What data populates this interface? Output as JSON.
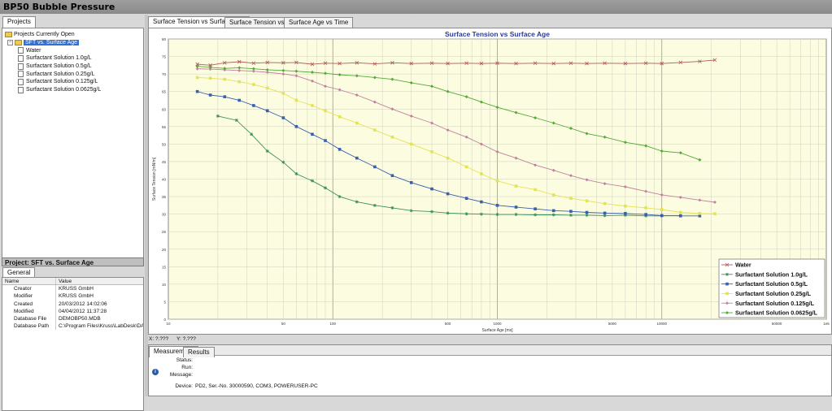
{
  "window": {
    "title": "BP50 Bubble Pressure"
  },
  "left_panel": {
    "tab": "Projects",
    "tree": {
      "root": "Projects Currently Open",
      "project": "SFT vs. Surface Age",
      "items": [
        "Water",
        "Surfactant Solution 1.0g/L",
        "Surfactant Solution 0.5g/L",
        "Surfactant Solution 0.25g/L",
        "Surfactant Solution 0.125g/L",
        "Surfactant Solution 0.0625g/L"
      ]
    }
  },
  "properties": {
    "header": "Project: SFT vs. Surface Age",
    "tab": "General",
    "columns": [
      "Name",
      "Value"
    ],
    "rows": [
      {
        "name": "Creator",
        "value": "KRUSS GmbH"
      },
      {
        "name": "Modifier",
        "value": "KRUSS GmbH"
      },
      {
        "name": "Created",
        "value": "20/03/2012 14:02:06"
      },
      {
        "name": "Modified",
        "value": "04/04/2012 11:37:28"
      },
      {
        "name": "Database File",
        "value": "DEMOBP50.MDB"
      },
      {
        "name": "Database Path",
        "value": "C:\\Program Files\\Kruss\\LabDesk\\DA"
      }
    ]
  },
  "chart_tabs": [
    "Surface Tension vs Surface Age",
    "Surface Tension vs Time",
    "Surface Age vs Time"
  ],
  "coords": {
    "x": "X: ?.???",
    "y": "Y: ?.???"
  },
  "bottom_panel": {
    "tabs": [
      "Measurement",
      "Results"
    ],
    "status_label": "Status:",
    "run_label": "Run:",
    "message_label": "Message:",
    "device_label": "Device:",
    "device_value": "PD2, Ser.-No. 30000590, COM3, POWERUSER-PC"
  },
  "colors": {
    "plot_bg": "#fcfde0",
    "title": "#2a3a9c"
  },
  "chart_data": {
    "type": "line",
    "title": "Surface Tension vs Surface Age",
    "xlabel": "Surface Age [ms]",
    "ylabel": "Surface Tension [mN/m]",
    "xscale": "log",
    "xlim": [
      10,
      100000
    ],
    "ylim": [
      0,
      80
    ],
    "x_tick_labels": [
      {
        "v": 10,
        "t": "10"
      },
      {
        "v": 50,
        "t": "50"
      },
      {
        "v": 100,
        "t": "100"
      },
      {
        "v": 500,
        "t": "500"
      },
      {
        "v": 1000,
        "t": "1000"
      },
      {
        "v": 5000,
        "t": "5000"
      },
      {
        "v": 10000,
        "t": "10000"
      },
      {
        "v": 50000,
        "t": "50000"
      },
      {
        "v": 100000,
        "t": "1e5"
      }
    ],
    "y_ticks": [
      0,
      5,
      10,
      15,
      20,
      25,
      30,
      35,
      40,
      45,
      50,
      55,
      60,
      65,
      70,
      75,
      80
    ],
    "grid": true,
    "legend_position": "bottom-right",
    "series": [
      {
        "name": "Water",
        "color": "#b05a5a",
        "marker": "x",
        "points": [
          [
            15,
            72.8
          ],
          [
            18,
            72.5
          ],
          [
            22,
            73.2
          ],
          [
            27,
            73.5
          ],
          [
            33,
            73.1
          ],
          [
            40,
            73.3
          ],
          [
            50,
            73.2
          ],
          [
            60,
            73.3
          ],
          [
            75,
            72.8
          ],
          [
            90,
            73.1
          ],
          [
            110,
            73.0
          ],
          [
            140,
            73.2
          ],
          [
            180,
            72.9
          ],
          [
            230,
            73.2
          ],
          [
            300,
            73.0
          ],
          [
            400,
            73.1
          ],
          [
            500,
            73.0
          ],
          [
            650,
            73.1
          ],
          [
            800,
            73.0
          ],
          [
            1000,
            73.1
          ],
          [
            1300,
            73.0
          ],
          [
            1700,
            73.1
          ],
          [
            2200,
            73.0
          ],
          [
            2800,
            73.1
          ],
          [
            3500,
            73.0
          ],
          [
            4500,
            73.1
          ],
          [
            6000,
            73.0
          ],
          [
            8000,
            73.1
          ],
          [
            10000,
            73.0
          ],
          [
            13000,
            73.3
          ],
          [
            17000,
            73.6
          ],
          [
            21000,
            74.0
          ]
        ]
      },
      {
        "name": "Surfactant Solution 1.0g/L",
        "color": "#3a8f5a",
        "marker": "star",
        "points": [
          [
            20,
            58
          ],
          [
            26,
            56.8
          ],
          [
            32,
            52.8
          ],
          [
            40,
            48
          ],
          [
            50,
            44.8
          ],
          [
            60,
            41.5
          ],
          [
            75,
            39.5
          ],
          [
            90,
            37.5
          ],
          [
            110,
            35
          ],
          [
            140,
            33.5
          ],
          [
            180,
            32.5
          ],
          [
            230,
            31.8
          ],
          [
            300,
            31
          ],
          [
            400,
            30.7
          ],
          [
            500,
            30.3
          ],
          [
            650,
            30.1
          ],
          [
            800,
            30
          ],
          [
            1000,
            29.9
          ],
          [
            1300,
            29.9
          ],
          [
            1700,
            29.8
          ],
          [
            2200,
            29.8
          ],
          [
            2800,
            29.7
          ],
          [
            3500,
            29.7
          ],
          [
            4500,
            29.6
          ],
          [
            6000,
            29.7
          ],
          [
            8000,
            29.5
          ],
          [
            10000,
            29.5
          ],
          [
            13000,
            29.6
          ]
        ]
      },
      {
        "name": "Surfactant Solution 0.5g/L",
        "color": "#3a5fb0",
        "marker": "square",
        "points": [
          [
            15,
            65
          ],
          [
            18,
            64
          ],
          [
            22,
            63.5
          ],
          [
            27,
            62.5
          ],
          [
            33,
            61
          ],
          [
            40,
            59.5
          ],
          [
            50,
            57.5
          ],
          [
            60,
            55
          ],
          [
            75,
            52.8
          ],
          [
            90,
            51
          ],
          [
            110,
            48.5
          ],
          [
            140,
            46
          ],
          [
            180,
            43.5
          ],
          [
            230,
            41
          ],
          [
            300,
            39
          ],
          [
            400,
            37.2
          ],
          [
            500,
            35.8
          ],
          [
            650,
            34.5
          ],
          [
            800,
            33.5
          ],
          [
            1000,
            32.5
          ],
          [
            1300,
            32
          ],
          [
            1700,
            31.5
          ],
          [
            2200,
            31
          ],
          [
            2800,
            30.8
          ],
          [
            3500,
            30.5
          ],
          [
            4500,
            30.3
          ],
          [
            6000,
            30.2
          ],
          [
            8000,
            29.9
          ],
          [
            10000,
            29.6
          ],
          [
            13000,
            29.5
          ],
          [
            17000,
            29.5
          ]
        ]
      },
      {
        "name": "Surfactant Solution 0.25g/L",
        "color": "#e3e356",
        "marker": "square",
        "points": [
          [
            15,
            69
          ],
          [
            18,
            68.8
          ],
          [
            22,
            68.5
          ],
          [
            27,
            67.8
          ],
          [
            33,
            67
          ],
          [
            40,
            66
          ],
          [
            50,
            64.5
          ],
          [
            60,
            62.5
          ],
          [
            75,
            61
          ],
          [
            90,
            59.5
          ],
          [
            110,
            57.8
          ],
          [
            140,
            56
          ],
          [
            180,
            54
          ],
          [
            230,
            52
          ],
          [
            300,
            50
          ],
          [
            400,
            47.8
          ],
          [
            500,
            46
          ],
          [
            650,
            43.5
          ],
          [
            800,
            41.5
          ],
          [
            1000,
            39.5
          ],
          [
            1300,
            38
          ],
          [
            1700,
            37
          ],
          [
            2200,
            35.5
          ],
          [
            2800,
            34.5
          ],
          [
            3500,
            33.8
          ],
          [
            4500,
            33
          ],
          [
            6000,
            32.3
          ],
          [
            8000,
            31.8
          ],
          [
            10000,
            31.3
          ],
          [
            13000,
            30.5
          ],
          [
            17000,
            30.2
          ],
          [
            21000,
            30.1
          ]
        ]
      },
      {
        "name": "Surfactant Solution 0.125g/L",
        "color": "#c080a0",
        "marker": "diamond",
        "points": [
          [
            15,
            71.5
          ],
          [
            18,
            71.4
          ],
          [
            22,
            71.2
          ],
          [
            27,
            71
          ],
          [
            33,
            70.8
          ],
          [
            40,
            70.5
          ],
          [
            50,
            70
          ],
          [
            60,
            69.5
          ],
          [
            75,
            68
          ],
          [
            90,
            66.5
          ],
          [
            110,
            65.5
          ],
          [
            140,
            64
          ],
          [
            180,
            62
          ],
          [
            230,
            60
          ],
          [
            300,
            58
          ],
          [
            400,
            56
          ],
          [
            500,
            54
          ],
          [
            650,
            52
          ],
          [
            800,
            50
          ],
          [
            1000,
            47.8
          ],
          [
            1300,
            46
          ],
          [
            1700,
            44
          ],
          [
            2200,
            42.5
          ],
          [
            2800,
            41
          ],
          [
            3500,
            39.8
          ],
          [
            4500,
            38.7
          ],
          [
            6000,
            37.8
          ],
          [
            8000,
            36.5
          ],
          [
            10000,
            35.5
          ],
          [
            13000,
            34.8
          ],
          [
            17000,
            34
          ],
          [
            21000,
            33.4
          ]
        ]
      },
      {
        "name": "Surfactant Solution 0.0625g/L",
        "color": "#55a838",
        "marker": "diamond",
        "points": [
          [
            15,
            72.2
          ],
          [
            18,
            71.9
          ],
          [
            22,
            71.6
          ],
          [
            27,
            71.8
          ],
          [
            33,
            71.5
          ],
          [
            40,
            71.2
          ],
          [
            50,
            71
          ],
          [
            60,
            70.8
          ],
          [
            75,
            70.5
          ],
          [
            90,
            70.2
          ],
          [
            110,
            69.8
          ],
          [
            140,
            69.5
          ],
          [
            180,
            69
          ],
          [
            230,
            68.5
          ],
          [
            300,
            67.5
          ],
          [
            400,
            66.5
          ],
          [
            500,
            65
          ],
          [
            650,
            63.5
          ],
          [
            800,
            62
          ],
          [
            1000,
            60.5
          ],
          [
            1300,
            59
          ],
          [
            1700,
            57.5
          ],
          [
            2200,
            56
          ],
          [
            2800,
            54.5
          ],
          [
            3500,
            53
          ],
          [
            4500,
            52
          ],
          [
            6000,
            50.5
          ],
          [
            8000,
            49.5
          ],
          [
            10000,
            48
          ],
          [
            13000,
            47.5
          ],
          [
            17000,
            45.5
          ]
        ]
      }
    ]
  }
}
